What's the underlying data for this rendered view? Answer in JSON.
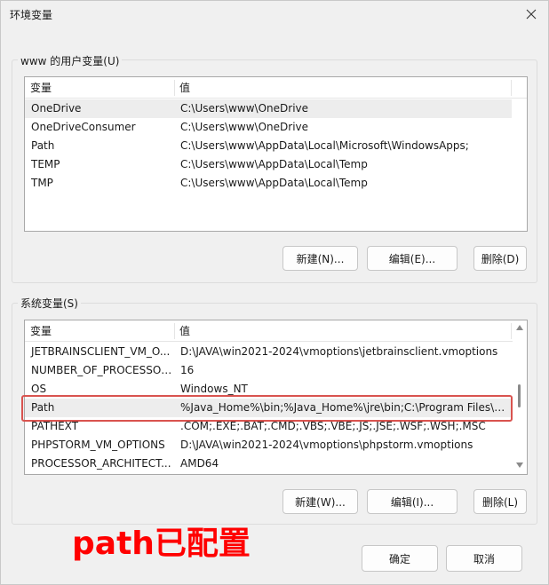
{
  "window": {
    "title": "环境变量"
  },
  "user_vars": {
    "group_label": "www 的用户变量(U)",
    "columns": [
      "变量",
      "值"
    ],
    "rows": [
      {
        "name": "OneDrive",
        "value": "C:\\Users\\www\\OneDrive"
      },
      {
        "name": "OneDriveConsumer",
        "value": "C:\\Users\\www\\OneDrive"
      },
      {
        "name": "Path",
        "value": "C:\\Users\\www\\AppData\\Local\\Microsoft\\WindowsApps;"
      },
      {
        "name": "TEMP",
        "value": "C:\\Users\\www\\AppData\\Local\\Temp"
      },
      {
        "name": "TMP",
        "value": "C:\\Users\\www\\AppData\\Local\\Temp"
      }
    ],
    "buttons": {
      "new": "新建(N)...",
      "edit": "编辑(E)...",
      "delete": "删除(D)"
    }
  },
  "system_vars": {
    "group_label": "系统变量(S)",
    "columns": [
      "变量",
      "值"
    ],
    "rows": [
      {
        "name": "JETBRAINSCLIENT_VM_O...",
        "value": "D:\\JAVA\\win2021-2024\\vmoptions\\jetbrainsclient.vmoptions"
      },
      {
        "name": "NUMBER_OF_PROCESSORS",
        "value": "16"
      },
      {
        "name": "OS",
        "value": "Windows_NT"
      },
      {
        "name": "Path",
        "value": "%Java_Home%\\bin;%Java_Home%\\jre\\bin;C:\\Program Files\\C..."
      },
      {
        "name": "PATHEXT",
        "value": ".COM;.EXE;.BAT;.CMD;.VBS;.VBE;.JS;.JSE;.WSF;.WSH;.MSC"
      },
      {
        "name": "PHPSTORM_VM_OPTIONS",
        "value": "D:\\JAVA\\win2021-2024\\vmoptions\\phpstorm.vmoptions"
      },
      {
        "name": "PROCESSOR_ARCHITECT...",
        "value": "AMD64"
      }
    ],
    "buttons": {
      "new": "新建(W)...",
      "edit": "编辑(I)...",
      "delete": "删除(L)"
    }
  },
  "footer": {
    "ok": "确定",
    "cancel": "取消"
  },
  "annotation": {
    "text": "path已配置",
    "color": "#ff0000"
  },
  "colors": {
    "highlight": "#d9534f",
    "selected_row": "#ededed"
  }
}
